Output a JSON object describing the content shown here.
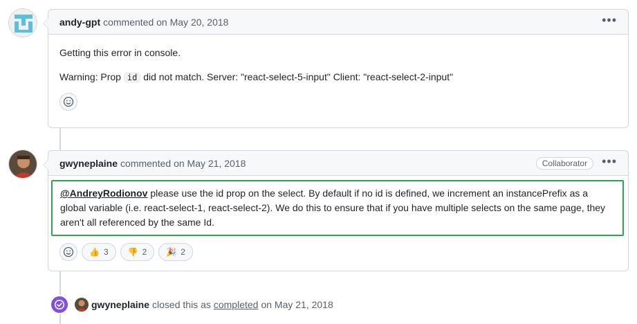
{
  "comments": [
    {
      "author": "andy-gpt",
      "meta": "commented on May 20, 2018",
      "menu_icon": "kebab-horizontal-icon",
      "body_line1": "Getting this error in console.",
      "body_warn_prefix": "Warning: Prop",
      "body_code": "id",
      "body_warn_suffix": "did not match. Server: \"react-select-5-input\" Client: \"react-select-2-input\""
    },
    {
      "author": "gwyneplaine",
      "meta": "commented on May 21, 2018",
      "badge": "Collaborator",
      "mention": "@AndreyRodionov",
      "body": " please use the id prop on the select. By default if no id is defined, we increment an instancePrefix as a global variable (i.e. react-select-1, react-select-2). We do this to ensure that if you have multiple selects on the same page, they aren't all referenced by the same Id.",
      "reactions": [
        {
          "icon": "thumbs-up-icon",
          "emoji": "👍",
          "count": "3"
        },
        {
          "icon": "thumbs-down-icon",
          "emoji": "👎",
          "count": "2"
        },
        {
          "icon": "party-popper-icon",
          "emoji": "🎉",
          "count": "2"
        }
      ]
    }
  ],
  "event": {
    "author": "gwyneplaine",
    "text_before": "closed this as",
    "link": "completed",
    "text_after": "on May 21, 2018",
    "icon": "check-circle-icon"
  },
  "colors": {
    "accent_purple": "#8250df",
    "highlight_green": "#2da44e",
    "border": "#d0d7de",
    "header_bg": "#f6f8fa"
  }
}
